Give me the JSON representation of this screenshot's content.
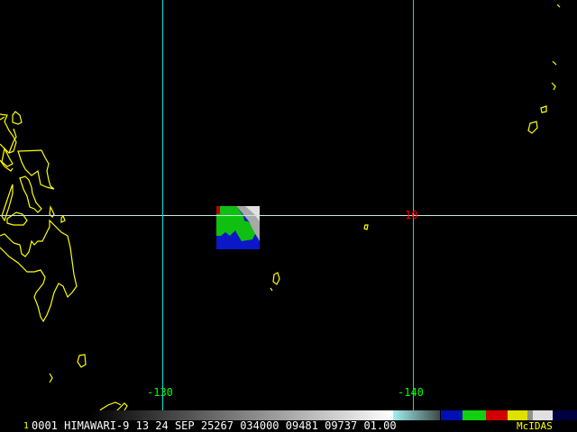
{
  "image": {
    "satellite_label": "HIMAWARI-9",
    "frame_number": "1",
    "info_text": "0001 HIMAWARI-9 13 24 SEP 25267 034000 09481 09737 01.00",
    "brand": "McIDAS"
  },
  "grid": {
    "longitude_labels": [
      "-130",
      "-140"
    ],
    "latitude_labels": [
      "10"
    ]
  },
  "colors": {
    "coastline": "#ffff00",
    "longitude_line": "#00e0e0",
    "latitude_line": "#c8e8e8",
    "longitude_label": "#00ff00",
    "latitude_label": "#ff0000",
    "brand": "#ffff00"
  }
}
